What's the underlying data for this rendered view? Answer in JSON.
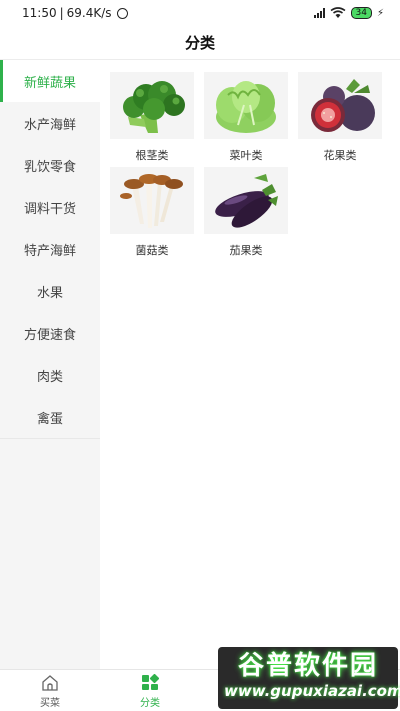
{
  "status_bar": {
    "time": "11:50",
    "speed": "69.4K/s",
    "battery": "34"
  },
  "header": {
    "title": "分类"
  },
  "sidebar": {
    "items": [
      {
        "label": "新鲜蔬果",
        "active": true
      },
      {
        "label": "水产海鲜"
      },
      {
        "label": "乳饮零食"
      },
      {
        "label": "调料干货"
      },
      {
        "label": "特产海鲜"
      },
      {
        "label": "水果"
      },
      {
        "label": "方便速食"
      },
      {
        "label": "肉类"
      },
      {
        "label": "禽蛋"
      }
    ]
  },
  "categories": [
    {
      "label": "根茎类",
      "icon": "broccoli-image"
    },
    {
      "label": "菜叶类",
      "icon": "lettuce-image"
    },
    {
      "label": "花果类",
      "icon": "fig-image"
    },
    {
      "label": "菌菇类",
      "icon": "mushroom-image"
    },
    {
      "label": "茄果类",
      "icon": "eggplant-image"
    }
  ],
  "tabbar": {
    "home_label": "买菜",
    "category_label": "分类"
  },
  "watermark": {
    "title": "谷普软件园",
    "url": "www.gupuxiazai.com"
  },
  "colors": {
    "accent": "#2fb14b"
  }
}
